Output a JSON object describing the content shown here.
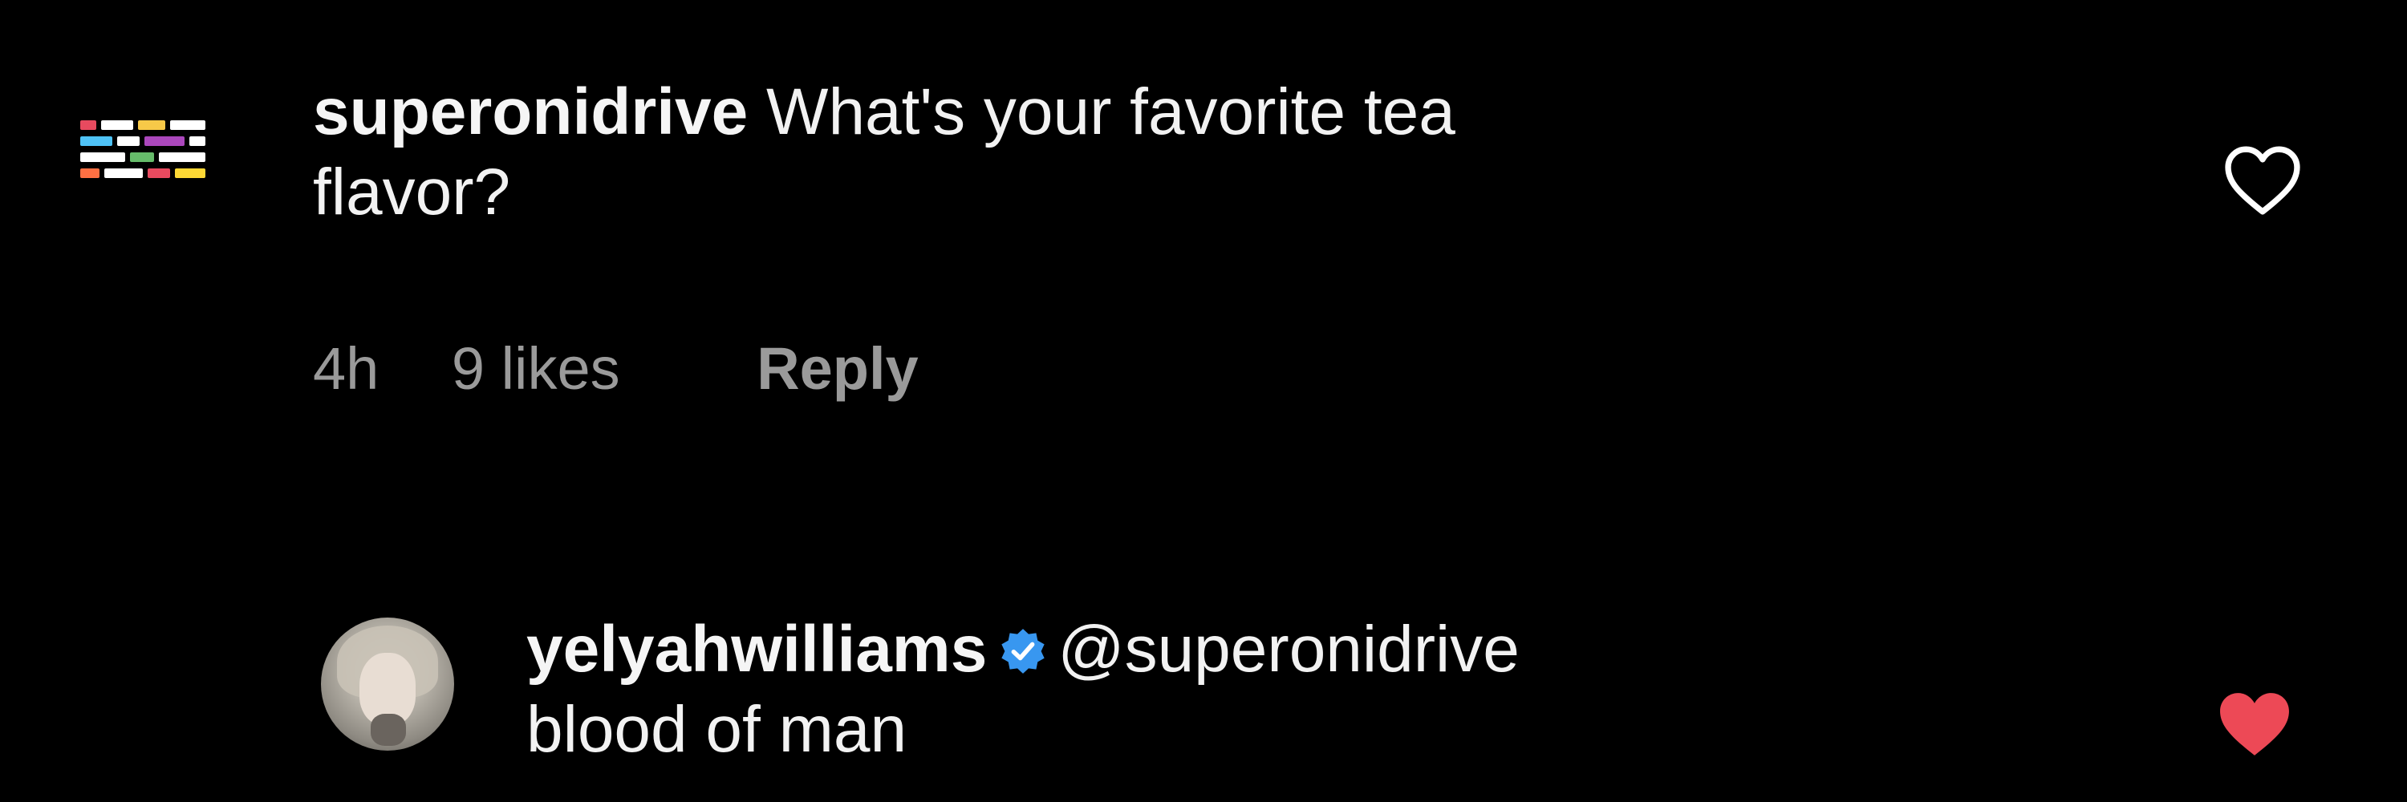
{
  "comments": [
    {
      "username": "superonidrive",
      "text_line1": "What's your favorite tea",
      "text_line2": "flavor?",
      "time": "4h",
      "likes": "9 likes",
      "reply_label": "Reply",
      "avatar_icon": "pixel-grid-avatar",
      "liked": false,
      "heart_icon": "heart-outline-icon"
    },
    {
      "username": "yelyahwilliams",
      "verified": true,
      "verified_icon": "verified-badge-icon",
      "mention": "@superonidrive",
      "text_line2": "blood of man",
      "avatar_icon": "profile-photo-avatar",
      "liked": true,
      "heart_icon": "heart-filled-icon"
    }
  ],
  "colors": {
    "background": "#000000",
    "text": "#f2f2f2",
    "meta": "#9a9a9a",
    "verified_blue": "#3897f0",
    "liked_heart": "#ed4956",
    "outline_heart": "#ffffff"
  }
}
